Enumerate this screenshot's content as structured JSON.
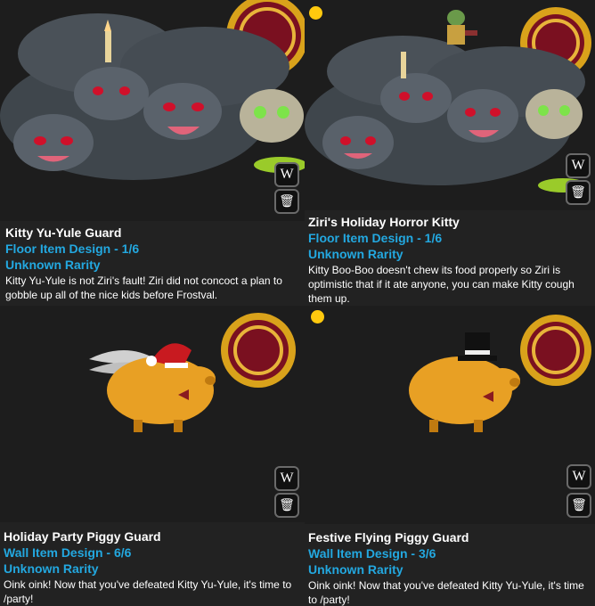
{
  "items": [
    {
      "title": "Kitty Yu-Yule Guard",
      "type": "Floor Item Design - 1/6",
      "rarity": "Unknown Rarity",
      "description": "Kitty Yu-Yule is not Ziri's fault! Ziri did not concoct a plan to gobble up all of the nice kids before Frostval.",
      "wiki_icon": "W",
      "trash_icon": "trash-icon",
      "ac_badge": "AC",
      "ac_badge_visible": true,
      "dot_visible": false
    },
    {
      "title": "Ziri's Holiday Horror Kitty",
      "type": "Floor Item Design - 1/6",
      "rarity": "Unknown Rarity",
      "description": "Kitty Boo-Boo doesn't chew its food properly so Ziri is optimistic that if it ate anyone, you can make Kitty cough them up.",
      "wiki_icon": "W",
      "trash_icon": "trash-icon",
      "ac_badge": "AC",
      "ac_badge_visible": true,
      "dot_visible": true
    },
    {
      "title": "Holiday Party Piggy Guard",
      "type": "Wall Item Design - 6/6",
      "rarity": "Unknown Rarity",
      "description": "Oink oink! Now that you've defeated Kitty Yu-Yule, it's time to /party!",
      "wiki_icon": "W",
      "trash_icon": "trash-icon",
      "ac_badge": "AC",
      "ac_badge_visible": true,
      "dot_visible": false
    },
    {
      "title": "Festive Flying Piggy Guard",
      "type": "Wall Item Design - 3/6",
      "rarity": "Unknown Rarity",
      "description": "Oink oink! Now that you've defeated Kitty Yu-Yule, it's time to /party!",
      "wiki_icon": "W",
      "trash_icon": "trash-icon",
      "ac_badge": "AC",
      "ac_badge_visible": true,
      "dot_visible": true
    }
  ],
  "colors": {
    "accent_blue": "#23a8e0",
    "badge_gold": "#d9a21b",
    "badge_red": "#7a1020",
    "dot_yellow": "#ffc90e",
    "panel_bg": "#222222"
  }
}
